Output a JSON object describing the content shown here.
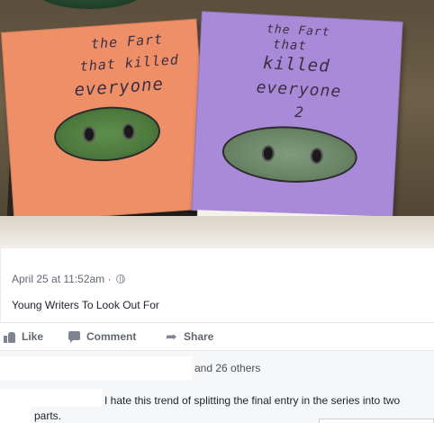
{
  "photo": {
    "orange_book": {
      "line1": "the Fart",
      "line2": "that killed",
      "line3": "everyone"
    },
    "purple_book": {
      "line1": "the Fart",
      "line2": "that",
      "line3": "killed",
      "line4": "everyone",
      "line5": "2"
    }
  },
  "post": {
    "timestamp": "April 25 at 11:52am",
    "separator": "·",
    "caption": "Young Writers To Look Out For"
  },
  "actions": {
    "like_label": "Like",
    "comment_label": "Comment",
    "share_label": "Share"
  },
  "reactions": {
    "others_text": "and 26 others"
  },
  "comment": {
    "text": "I hate this trend of splitting the final entry in the series into two parts."
  }
}
